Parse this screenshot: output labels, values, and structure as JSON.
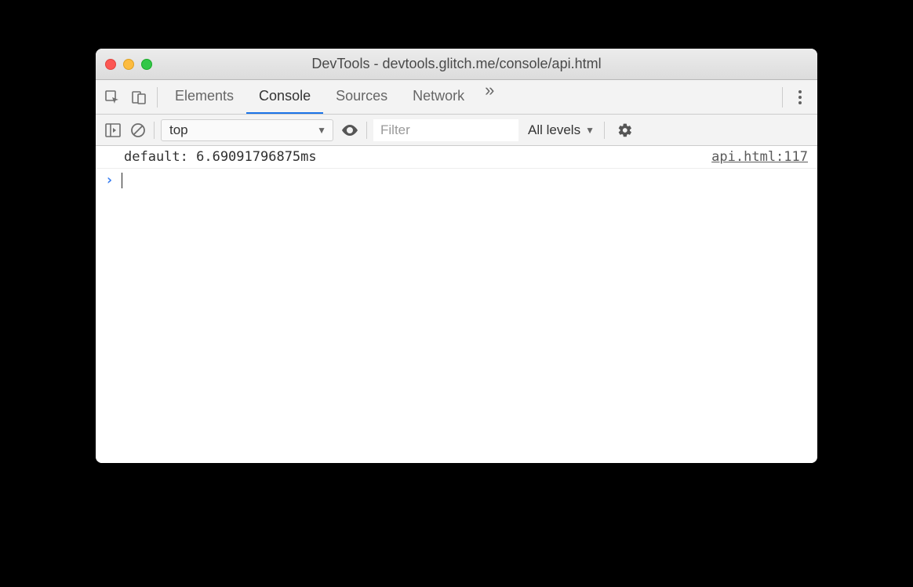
{
  "window": {
    "title": "DevTools - devtools.glitch.me/console/api.html"
  },
  "tabs": {
    "elements": "Elements",
    "console": "Console",
    "sources": "Sources",
    "network": "Network"
  },
  "toolbar": {
    "context": "top",
    "filter_placeholder": "Filter",
    "levels": "All levels"
  },
  "console": {
    "log": {
      "message": "default: 6.69091796875ms",
      "source": "api.html:117"
    },
    "prompt_caret": "›"
  }
}
